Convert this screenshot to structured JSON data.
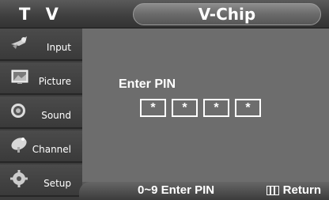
{
  "header": {
    "tv_label": "T V",
    "title": "V-Chip"
  },
  "sidebar": {
    "items": [
      {
        "label": "Input",
        "icon": "input-icon"
      },
      {
        "label": "Picture",
        "icon": "picture-icon"
      },
      {
        "label": "Sound",
        "icon": "sound-icon"
      },
      {
        "label": "Channel",
        "icon": "channel-icon"
      },
      {
        "label": "Setup",
        "icon": "setup-icon"
      }
    ]
  },
  "main": {
    "prompt": "Enter PIN",
    "pin_digits": [
      "*",
      "*",
      "*",
      "*"
    ]
  },
  "footer": {
    "hint": "0~9 Enter PIN",
    "return_label": "Return",
    "return_icon": "menu-icon"
  },
  "colors": {
    "panel": "#6d6d6d",
    "sidebar": "#3c3c3c",
    "text": "#ffffff"
  }
}
